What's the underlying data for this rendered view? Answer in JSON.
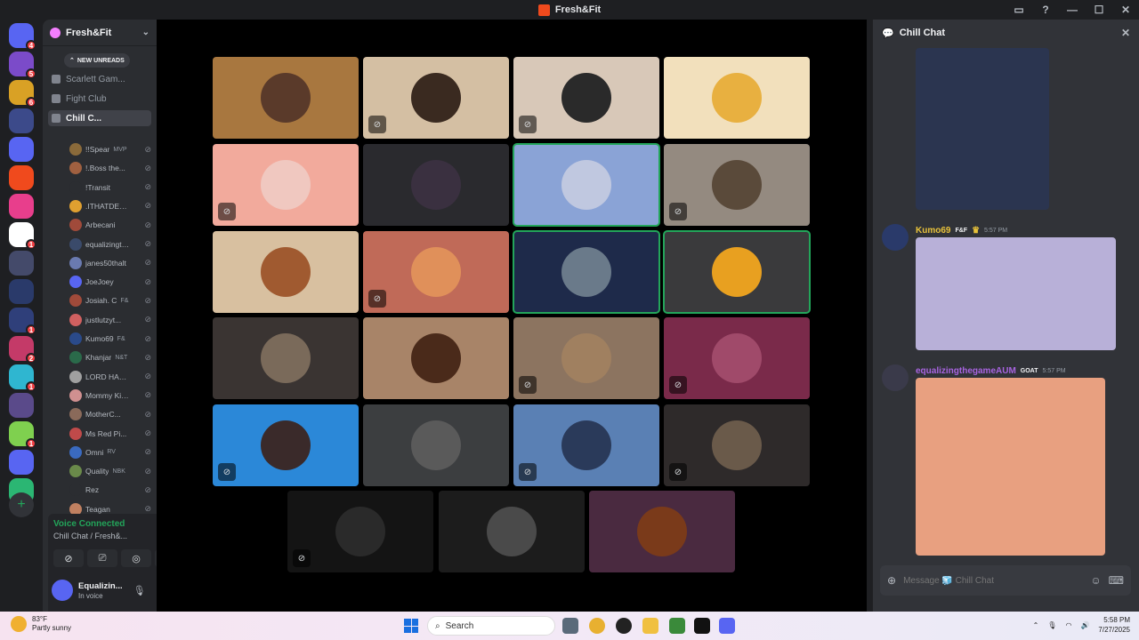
{
  "window": {
    "title": "Fresh&Fit"
  },
  "rail": {
    "servers": [
      {
        "name": "discord-home",
        "color": "#5865f2",
        "badge": "4"
      },
      {
        "name": "server-1",
        "color": "#7b4bc9",
        "badge": "5"
      },
      {
        "name": "server-classic",
        "color": "#d9a125",
        "badge": "6"
      },
      {
        "name": "server-3",
        "color": "#3c4a8a",
        "badge": ""
      },
      {
        "name": "folder",
        "color": "#5865f2",
        "badge": ""
      },
      {
        "name": "server-fresh-fit",
        "color": "#f04a1d",
        "badge": ""
      },
      {
        "name": "server-6",
        "color": "#e83e8c",
        "badge": ""
      },
      {
        "name": "server-7",
        "color": "#ffffff",
        "badge": "1"
      },
      {
        "name": "server-8",
        "color": "#444a6a",
        "badge": ""
      },
      {
        "name": "server-9",
        "color": "#2a3a6a",
        "badge": ""
      },
      {
        "name": "server-10",
        "color": "#2f3f7a",
        "badge": "1"
      },
      {
        "name": "server-11",
        "color": "#c43a68",
        "badge": "2"
      },
      {
        "name": "server-12",
        "color": "#2fb6d0",
        "badge": "1"
      },
      {
        "name": "server-13",
        "color": "#5a4a8a",
        "badge": ""
      },
      {
        "name": "server-14",
        "color": "#7fd04f",
        "badge": "1"
      },
      {
        "name": "folder-2",
        "color": "#5865f2",
        "badge": ""
      },
      {
        "name": "server-16",
        "color": "#2bb673",
        "badge": ""
      }
    ],
    "add_label": "+"
  },
  "sidebar": {
    "server_name": "Fresh&Fit",
    "new_unreads": "NEW UNREADS",
    "channels": [
      {
        "label": "Scarlett Gam...",
        "icon": "lock-icon"
      },
      {
        "label": "Fight Club",
        "icon": "lock-icon"
      },
      {
        "label": "Chill C...",
        "icon": "speaker-icon",
        "active": true
      }
    ],
    "members": [
      {
        "name": "!!Spear",
        "tag": "MVP",
        "color": "#8a6a3a"
      },
      {
        "name": "!.Boss the...",
        "tag": "",
        "color": "#a06040"
      },
      {
        "name": "!Transit",
        "tag": "",
        "color": "#2b2d31"
      },
      {
        "name": ".ITHATDEAL...",
        "tag": "",
        "color": "#e0a030"
      },
      {
        "name": "Arbecani",
        "tag": "",
        "color": "#a04a3a"
      },
      {
        "name": "equalizingth...",
        "tag": "",
        "color": "#3a4a6a"
      },
      {
        "name": "janes50thalt",
        "tag": "",
        "color": "#6a7ab0"
      },
      {
        "name": "JoeJoey",
        "tag": "",
        "color": "#5865f2"
      },
      {
        "name": "Josiah. C",
        "tag": "F&",
        "color": "#a04a3a"
      },
      {
        "name": "justlutzyt...",
        "tag": "",
        "color": "#d06060"
      },
      {
        "name": "Kumo69",
        "tag": "F&",
        "color": "#2a4a8a"
      },
      {
        "name": "Khanjar",
        "tag": "N&T",
        "color": "#2a6a4a"
      },
      {
        "name": "LORD HAM T...",
        "tag": "",
        "color": "#a0a0a0"
      },
      {
        "name": "Mommy Kim...",
        "tag": "",
        "color": "#d09090"
      },
      {
        "name": "MotherC...",
        "tag": "",
        "color": "#8a6a5a"
      },
      {
        "name": "Ms Red Pi...",
        "tag": "",
        "color": "#c04a4a"
      },
      {
        "name": "Omni",
        "tag": "RV",
        "color": "#3a6ac0"
      },
      {
        "name": "Quality",
        "tag": "NBK",
        "color": "#6a8a4a"
      },
      {
        "name": "Rez",
        "tag": "",
        "color": "#2b2d31"
      },
      {
        "name": "Teagan",
        "tag": "",
        "color": "#c08060"
      }
    ],
    "voice": {
      "status": "Voice Connected",
      "channel": "Chill Chat / Fresh&...",
      "user_name": "Equalizin...",
      "user_status": "In voice"
    }
  },
  "stage": {
    "tiles": [
      {
        "bg": "#a8773f",
        "av": "#5a3a2a",
        "muted": false,
        "speaking": false
      },
      {
        "bg": "#d4bfa3",
        "av": "#3a2a20",
        "muted": true,
        "speaking": false
      },
      {
        "bg": "#d8c8b8",
        "av": "#2a2a2a",
        "muted": true,
        "speaking": false
      },
      {
        "bg": "#f2e0bc",
        "av": "#e8b040",
        "muted": false,
        "speaking": false
      },
      {
        "bg": "#f2aa9c",
        "av": "#f0c8c0",
        "muted": true,
        "speaking": false
      },
      {
        "bg": "#2a2a2e",
        "av": "#3a3040",
        "muted": false,
        "speaking": false
      },
      {
        "bg": "#8aa3d6",
        "av": "#c0c8e0",
        "muted": false,
        "speaking": true
      },
      {
        "bg": "#948a80",
        "av": "#5a4a3a",
        "muted": true,
        "speaking": false
      },
      {
        "bg": "#d8c0a0",
        "av": "#a05a30",
        "muted": false,
        "speaking": false
      },
      {
        "bg": "#c06a58",
        "av": "#e0905a",
        "muted": true,
        "speaking": false
      },
      {
        "bg": "#1e2a4a",
        "av": "#6a7a8a",
        "muted": false,
        "speaking": true
      },
      {
        "bg": "#3a3a3c",
        "av": "#e8a020",
        "muted": false,
        "speaking": true
      },
      {
        "bg": "#3a3432",
        "av": "#7a6a5a",
        "muted": false,
        "speaking": false
      },
      {
        "bg": "#a88468",
        "av": "#4a2a1a",
        "muted": false,
        "speaking": false
      },
      {
        "bg": "#8c7460",
        "av": "#a08060",
        "muted": true,
        "speaking": false
      },
      {
        "bg": "#7a2a4a",
        "av": "#a04a6a",
        "muted": true,
        "speaking": false
      },
      {
        "bg": "#2b88d8",
        "av": "#3a2a2a",
        "muted": true,
        "speaking": false
      },
      {
        "bg": "#3c3e40",
        "av": "#5a5a5a",
        "muted": false,
        "speaking": false
      },
      {
        "bg": "#5a80b4",
        "av": "#2a3a5a",
        "muted": true,
        "speaking": false
      },
      {
        "bg": "#2e2a2a",
        "av": "#6a5a4a",
        "muted": true,
        "speaking": false
      },
      {
        "bg": "#141414",
        "av": "#2a2a2a",
        "muted": true,
        "speaking": false
      },
      {
        "bg": "#1c1c1c",
        "av": "#4a4a4a",
        "muted": false,
        "speaking": false
      },
      {
        "bg": "#4a2a40",
        "av": "#7a3a1a",
        "muted": false,
        "speaking": false
      }
    ]
  },
  "chat": {
    "title": "Chill Chat",
    "messages": [
      {
        "author": "Kumo69",
        "author_color": "#e8c23a",
        "role": "F&F",
        "time": "5:57 PM",
        "av": "#2a3a6a"
      },
      {
        "author": "equalizingthegameAUM",
        "author_color": "#a864e0",
        "role": "GOAT",
        "time": "5:57 PM",
        "av": "#3a3a4a"
      }
    ],
    "composer_placeholder": "Message 🧊 Chill Chat"
  },
  "taskbar": {
    "weather_temp": "83°F",
    "weather_desc": "Partly sunny",
    "search_label": "Search",
    "time": "5:58 PM",
    "date": "7/27/2025"
  }
}
